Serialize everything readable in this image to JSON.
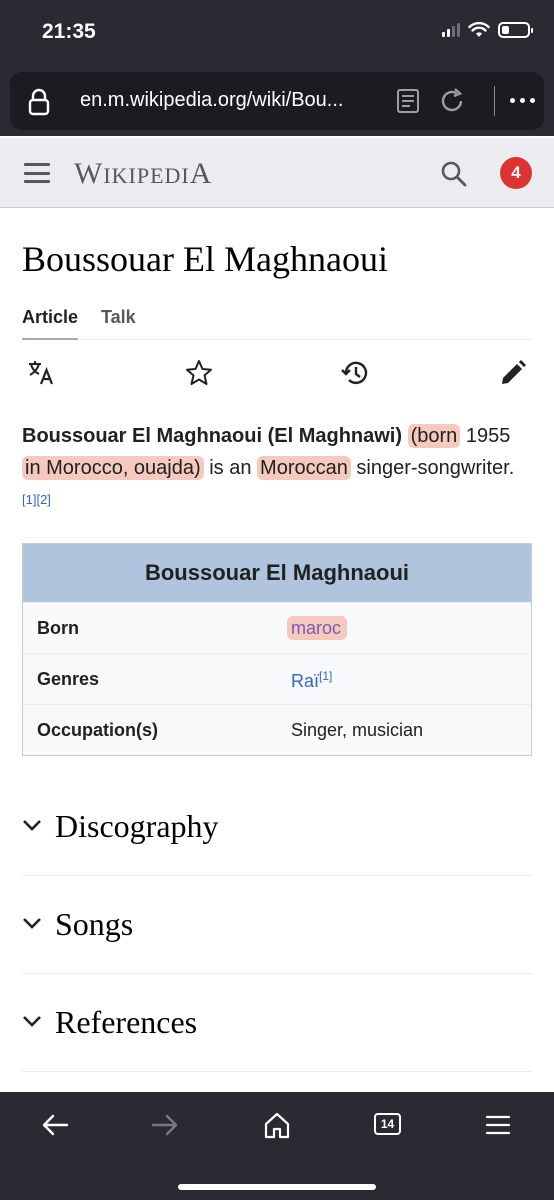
{
  "status_bar": {
    "time": "21:35"
  },
  "browser": {
    "url": "en.m.wikipedia.org/wiki/Bou...",
    "tab_count": "14",
    "icons": [
      "lock-icon",
      "reader-view-icon",
      "reload-icon",
      "more-menu-icon",
      "back-icon",
      "forward-icon",
      "home-icon",
      "tabs-icon",
      "app-menu-icon"
    ]
  },
  "wiki_header": {
    "wordmark": "WIKIPEDIA",
    "wordmark_first": "W",
    "wordmark_mid": "IKIPEDI",
    "wordmark_last": "A",
    "notifications": "4"
  },
  "page": {
    "title": "Boussouar El Maghnaoui",
    "tabs": [
      {
        "label": "Article",
        "active": true
      },
      {
        "label": "Talk",
        "active": false
      }
    ],
    "actions": [
      "language-icon",
      "watch-star-icon",
      "history-icon",
      "edit-pencil-icon"
    ]
  },
  "lead": {
    "name_bold": "Boussouar El Maghnaoui (El Maghnawi)",
    "part_born": "(born",
    "year": "1955",
    "part_place": "in Morocco, ouajda)",
    "part_is_an": "is an",
    "nationality": "Moroccan",
    "part_rest": "singer-songwriter.",
    "refs": "[1][2]"
  },
  "infobox": {
    "title": "Boussouar El Maghnaoui",
    "rows": [
      {
        "label": "Born",
        "value": "maroc"
      },
      {
        "label": "Genres",
        "value": "Raï",
        "ref": "[1]"
      },
      {
        "label": "Occupation(s)",
        "value": "Singer, musician"
      }
    ]
  },
  "sections": [
    {
      "title": "Discography"
    },
    {
      "title": "Songs"
    },
    {
      "title": "References"
    }
  ],
  "colors": {
    "highlight": "#f6c9bf",
    "infobox_header": "#b0c4de",
    "link": "#3366cc",
    "notification": "#dd3333",
    "browser_chrome": "#2b2a33"
  }
}
